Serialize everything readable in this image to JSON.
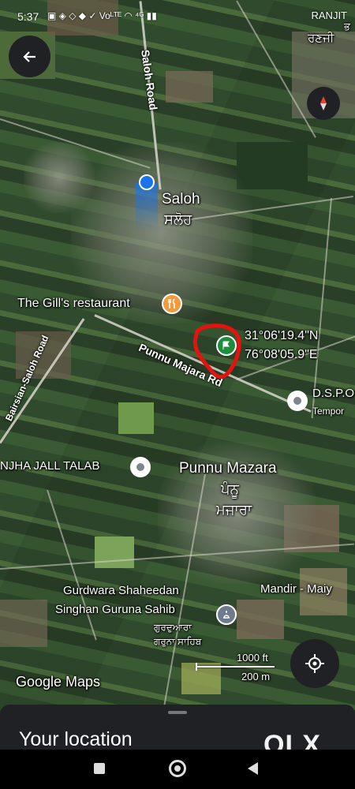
{
  "status_bar": {
    "time": "5:37",
    "operator": "RANJIT",
    "icons_text": "▣ ◈ ◇ ◆ ✓ Voᴸᵀᴱ ◠ ⁴ᴳ ▮▮"
  },
  "map": {
    "road_labels": {
      "saloh_road": "Saloh Road",
      "punnu_majara_rd": "Punnu Majara Rd",
      "bairsian_saloh_road": "Bairsian-Saloh Road"
    },
    "place_labels": {
      "saloh": "Saloh",
      "saloh_punjabi": "ਸਲੋਹ",
      "ranjit_punjabi": "ਰਣਜੀ",
      "gills_restaurant": "The Gill's restaurant",
      "jall_talab": "NJHA JALL TALAB",
      "punnu_mazara": "Punnu Mazara",
      "punnu_punjabi_1": "ਪੰਨੂ",
      "punnu_punjabi_2": "ਮਜਾਰਾ",
      "dsp": "D.S.P.O",
      "dsp_sub": "Tempor",
      "mandir": "Mandir - Maiy",
      "gurdwara_line1": "Gurdwara Shaheedan",
      "gurdwara_line2": "Singhan Guruna Sahib",
      "gurdwara_punjabi_1": "ਗੁਰਦੁਆਰਾ",
      "gurdwara_punjabi_2": "ਗਰੁਨਾ ਸਾਹਿਬ",
      "bottom_right_code": "ਭ"
    },
    "coordinates": {
      "latitude": "31°06'19.4\"N",
      "longitude": "76°08'05.9\"E"
    },
    "scale": {
      "feet": "1000 ft",
      "meters": "200 m"
    },
    "attribution": "Google Maps",
    "flag_accent": "#1e8e3e",
    "annotation_color": "#e5120f",
    "location_dot_color": "#1a73e8"
  },
  "bottom_sheet": {
    "title": "Your location"
  },
  "watermark": "OLX"
}
